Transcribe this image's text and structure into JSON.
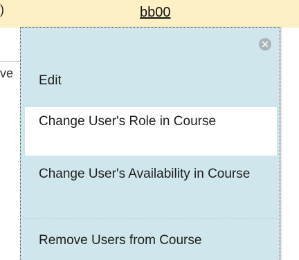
{
  "background_row": {
    "left_fragment": ")",
    "username": "bb00",
    "clipped_text": "ve"
  },
  "menu": {
    "close_glyph": "✕",
    "items": [
      {
        "label": "Edit"
      },
      {
        "label": "Change User's Role in Course"
      },
      {
        "label": "Change User's Availability in Course"
      },
      {
        "label": "Remove Users from Course"
      }
    ]
  }
}
